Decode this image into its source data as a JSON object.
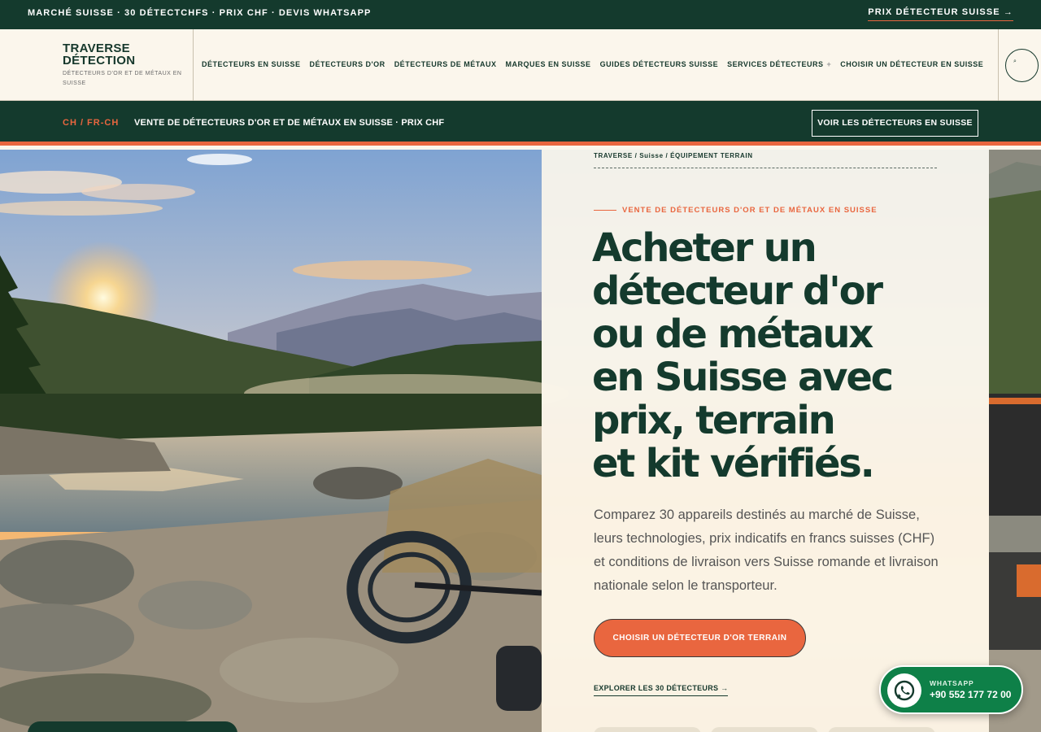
{
  "topbar": {
    "left_text": "MARCHÉ SUISSE · 30 DÉTECTCHFS · PRIX CHF · DEVIS WHATSAPP",
    "right_link": "PRIX DÉTECTEUR SUISSE →"
  },
  "header": {
    "brand_line1": "TRAVERSE",
    "brand_line2": "DÉTECTION",
    "brand_tagline": "DÉTECTEURS D'OR ET DE MÉTAUX EN SUISSE",
    "nav": [
      {
        "label": "DÉTECTEURS EN SUISSE"
      },
      {
        "label": "DÉTECTEURS D'OR"
      },
      {
        "label": "DÉTECTEURS DE MÉTAUX"
      },
      {
        "label": "MARQUES EN SUISSE"
      },
      {
        "label": "GUIDES DÉTECTEURS SUISSE"
      },
      {
        "label": "SERVICES DÉTECTEURS",
        "suffix": "+"
      },
      {
        "label": "CHOISIR UN DÉTECTEUR EN SUISSE"
      }
    ],
    "search_glyph": "⌕"
  },
  "band": {
    "locale": "CH / FR-CH",
    "message": "VENTE DE DÉTECTEURS D'OR ET DE MÉTAUX EN SUISSE · PRIX CHF",
    "cta": "VOIR LES DÉTECTEURS EN SUISSE"
  },
  "hero": {
    "breadcrumb": "TRAVERSE / Suisse / ÉQUIPEMENT TERRAIN",
    "eyebrow": "VENTE DE DÉTECTEURS D'OR ET DE MÉTAUX EN SUISSE",
    "title_lines": [
      "Acheter un",
      "détecteur d'or",
      "ou de métaux",
      "en Suisse avec",
      "prix, terrain",
      "et kit vérifiés."
    ],
    "lead": "Comparez 30 appareils destinés au marché de Suisse, leurs technologies, prix indicatifs en francs suisses (CHF) et conditions de livraison vers Suisse romande et livraison nationale selon le transporteur.",
    "primary_button": "CHOISIR UN DÉTECTEUR D'OR TERRAIN",
    "secondary_link": "EXPLORER LES 30 DÉTECTEURS →"
  },
  "whatsapp": {
    "label": "WHATSAPP",
    "number": "+90 552 177 72 00",
    "icon": "whatsapp-icon"
  },
  "colors": {
    "brand_green": "#143a2d",
    "accent_orange": "#e9663f",
    "cream": "#fbf6ec",
    "whatsapp_green": "#0e8048"
  }
}
